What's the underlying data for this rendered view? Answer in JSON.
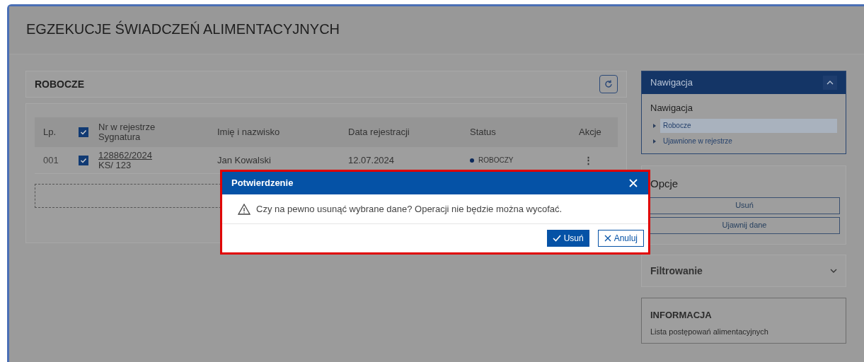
{
  "page": {
    "title": "EGZEKUCJE ŚWIADCZEŃ ALIMENTACYJNYCH"
  },
  "main": {
    "title": "ROBOCZE",
    "table": {
      "all_checked": true,
      "columns": [
        {
          "label": "Lp."
        },
        {
          "label": "Nr w rejestrze",
          "sub": "Sygnatura"
        },
        {
          "label": "Imię i nazwisko"
        },
        {
          "label": "Data rejestracji"
        },
        {
          "label": "Status"
        },
        {
          "label": "Akcje"
        }
      ],
      "rows": [
        {
          "lp": "001",
          "checked": true,
          "number": "128862/2024",
          "signature": "KS/ 123",
          "name": "Jan Kowalski",
          "date": "12.07.2024",
          "status": "ROBOCZY",
          "color": "#0d2a5a",
          "actions": "⋮"
        }
      ]
    }
  },
  "sidebar": {
    "navigation": {
      "header": "Nawigacja",
      "expanded": true,
      "title": "Nawigacja",
      "items": [
        {
          "label": "Robocze",
          "selected": true
        },
        {
          "label": "Ujawnione w rejestrze",
          "selected": false
        }
      ]
    },
    "options": {
      "title": "Opcje",
      "buttons": [
        "Usuń",
        "Ujawnij dane"
      ]
    },
    "filter": {
      "title": "Filtrowanie",
      "expanded": false
    },
    "info": {
      "title": "INFORMACJA",
      "text": "Lista postępowań alimentacyjnych"
    }
  },
  "dialog": {
    "title": "Potwierdzenie",
    "message": "Czy na pewno usunąć wybrane dane? Operacji nie będzie można wycofać.",
    "confirm": "Usuń",
    "cancel": "Anuluj"
  }
}
